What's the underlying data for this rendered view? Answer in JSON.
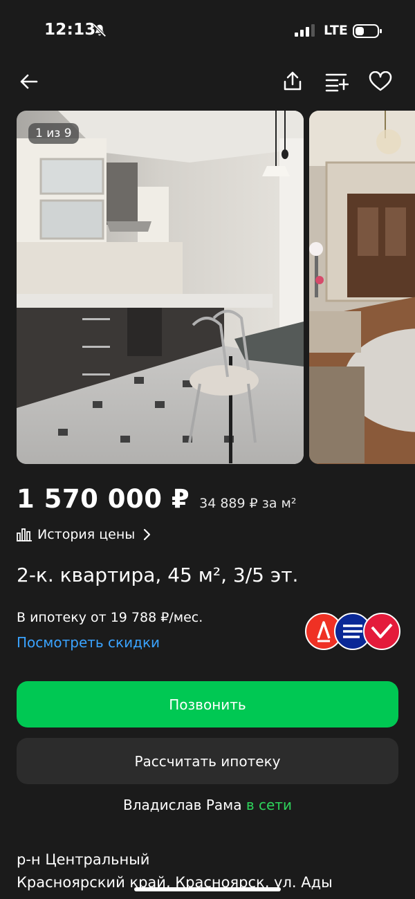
{
  "status_bar": {
    "time": "12:13",
    "network": "LTE"
  },
  "nav": {
    "back_icon": "arrow-left-icon",
    "share_icon": "share-icon",
    "compare_icon": "compare-list-icon",
    "favorite_icon": "heart-icon"
  },
  "gallery": {
    "counter": "1 из 9"
  },
  "listing": {
    "price": "1 570 000 ₽",
    "price_per_m2": "34 889 ₽ за м²",
    "price_history_label": "История цены",
    "title": "2-к. квартира, 45 м², 3/5 эт.",
    "mortgage_text": "В ипотеку от 19 788 ₽/мес.",
    "discounts_link": "Посмотреть скидки"
  },
  "actions": {
    "call_label": "Позвонить",
    "mortgage_calc_label": "Рассчитать ипотеку"
  },
  "seller": {
    "name": "Владислав Рама",
    "status": "в сети"
  },
  "address": {
    "district": "р-н Центральный",
    "line": "Красноярский край, Красноярск, ул. Ады"
  },
  "colors": {
    "background": "#1b1b1b",
    "call_button": "#00c853",
    "link": "#3aa3ff",
    "online": "#2ed35b"
  }
}
